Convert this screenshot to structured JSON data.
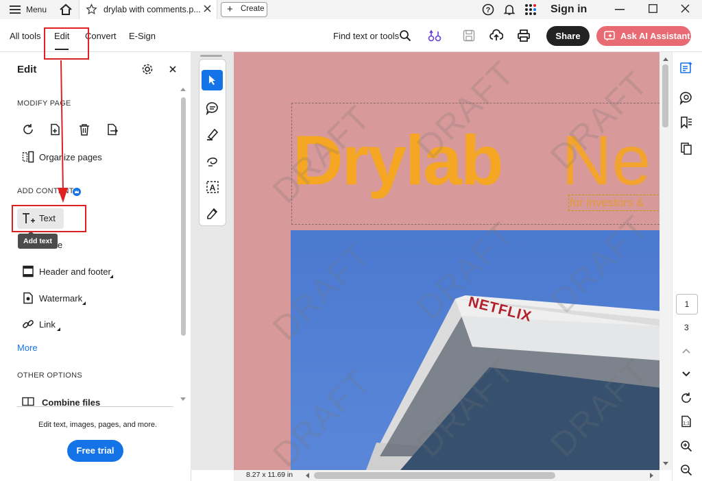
{
  "titlebar": {
    "menu_label": "Menu",
    "tab_title": "drylab with comments.p...",
    "create_label": "Create",
    "sign_in": "Sign in"
  },
  "toolbar": {
    "nav": [
      "All tools",
      "Edit",
      "Convert",
      "E-Sign"
    ],
    "find_label": "Find text or tools",
    "share_label": "Share",
    "ai_label": "Ask AI Assistant"
  },
  "panel": {
    "title": "Edit",
    "modify_heading": "MODIFY PAGE",
    "organize_label": "Organize pages",
    "add_heading": "ADD CONTENT",
    "text_label": "Text",
    "tooltip": "Add text",
    "image_partial": "e",
    "header_footer": "Header and footer",
    "watermark": "Watermark",
    "link": "Link",
    "more": "More",
    "other_heading": "OTHER OPTIONS",
    "combine": "Combine files",
    "footer_text": "Edit text, images, pages, and more.",
    "free_trial": "Free trial"
  },
  "document": {
    "title_bold": "Drylab",
    "title_light": "Ne",
    "subtitle": "for investors &",
    "sign_text": "NETFLIX",
    "watermark_text": "DRAFT",
    "page_size": "8.27 x 11.69 in"
  },
  "pagenav": {
    "current": "1",
    "total": "3"
  },
  "colors": {
    "accent": "#1473e6",
    "ai_button": "#e86a72",
    "page_bg": "#d7999a",
    "title_orange": "#f5a623",
    "annotation_red": "#e02020"
  }
}
